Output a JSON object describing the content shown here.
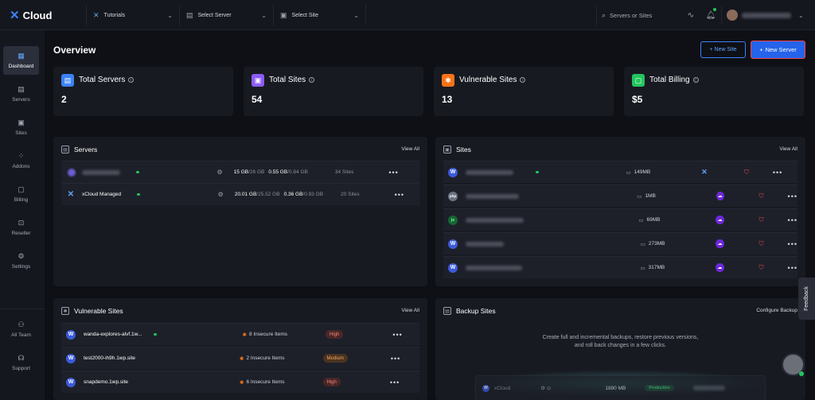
{
  "topbar": {
    "logo": "Cloud",
    "tutorials": "Tutorials",
    "select_server": "Select Server",
    "select_site": "Select Site",
    "search_placeholder": "Servers or Sites"
  },
  "sidebar": {
    "items": [
      {
        "label": "Dashboard",
        "icon": "dashboard-icon"
      },
      {
        "label": "Servers",
        "icon": "server-icon"
      },
      {
        "label": "Sites",
        "icon": "site-icon"
      },
      {
        "label": "Addons",
        "icon": "addons-icon"
      },
      {
        "label": "Billing",
        "icon": "billing-icon"
      },
      {
        "label": "Reseller",
        "icon": "reseller-icon"
      },
      {
        "label": "Settings",
        "icon": "gear-icon"
      },
      {
        "label": "All Team",
        "icon": "team-icon"
      },
      {
        "label": "Support",
        "icon": "headset-icon"
      }
    ]
  },
  "page": {
    "title": "Overview",
    "new_site": "New Site",
    "new_server": "New Server"
  },
  "stats": [
    {
      "label": "Total Servers",
      "value": "2",
      "color": "#3b82f6"
    },
    {
      "label": "Total Sites",
      "value": "54",
      "color": "#8b5cf6"
    },
    {
      "label": "Vulnerable Sites",
      "value": "13",
      "color": "#f97316"
    },
    {
      "label": "Total Billing",
      "value": "$5",
      "color": "#22c55e"
    }
  ],
  "servers": {
    "title": "Servers",
    "view_all": "View All",
    "rows": [
      {
        "name": "",
        "disk_used": "15 GB",
        "disk_total": "/26 GB",
        "ram_used": "0.55 GB",
        "ram_total": "/0.84 GB",
        "sites": "34 Sites"
      },
      {
        "name": "xCloud Managed",
        "disk_used": "20.01 GB",
        "disk_total": "/25.52 GB",
        "ram_used": "0.36 GB",
        "ram_total": "/0.93 GB",
        "sites": "20 Sites"
      }
    ]
  },
  "sites": {
    "title": "Sites",
    "view_all": "View All",
    "rows": [
      {
        "icon": "W",
        "size": "149MB"
      },
      {
        "icon": "php",
        "size": "1MB"
      },
      {
        "icon": "js",
        "size": "69MB"
      },
      {
        "icon": "W",
        "size": "273MB"
      },
      {
        "icon": "W",
        "size": "317MB"
      }
    ]
  },
  "vulnerable": {
    "title": "Vulnerable Sites",
    "view_all": "View All",
    "rows": [
      {
        "name": "wanda-explores-alvf.1w...",
        "items": "8 Insecure Items",
        "level": "High"
      },
      {
        "name": "test2000-ih9h.1wp.site",
        "items": "2 Insecure Items",
        "level": "Medium"
      },
      {
        "name": "snapdemo.1wp.site",
        "items": "6 Insecure Items",
        "level": "High"
      }
    ]
  },
  "backup": {
    "title": "Backup Sites",
    "configure": "Configure Backup",
    "description": "Create full and incremental backups, restore previous versions, and roll back changes in a few clicks.",
    "preview": {
      "name": "xCloud",
      "size": "1890 MB",
      "tag": "Production"
    }
  },
  "feedback": "Feedback"
}
